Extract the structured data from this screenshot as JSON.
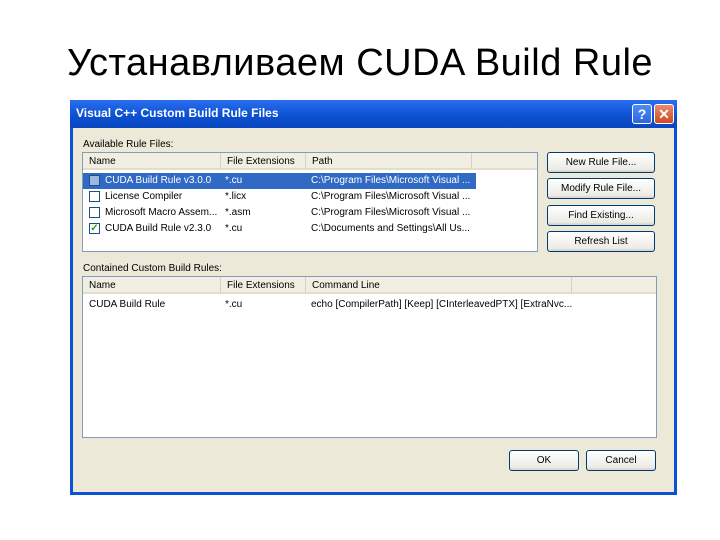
{
  "slide": {
    "title": "Устанавливаем CUDA Build Rule"
  },
  "dialog": {
    "title": "Visual C++ Custom Build Rule Files",
    "help_glyph": "?",
    "close_glyph": "✕",
    "available_label": "Available Rule Files:",
    "available_columns": [
      "Name",
      "File Extensions",
      "Path"
    ],
    "available_rows": [
      {
        "checked": false,
        "selected": true,
        "name": "CUDA Build Rule v3.0.0",
        "ext": "*.cu",
        "path": "C:\\Program Files\\Microsoft Visual ..."
      },
      {
        "checked": false,
        "selected": false,
        "name": "License Compiler",
        "ext": "*.licx",
        "path": "C:\\Program Files\\Microsoft Visual ..."
      },
      {
        "checked": false,
        "selected": false,
        "name": "Microsoft Macro Assem...",
        "ext": "*.asm",
        "path": "C:\\Program Files\\Microsoft Visual ..."
      },
      {
        "checked": true,
        "selected": false,
        "name": "CUDA Build Rule v2.3.0",
        "ext": "*.cu",
        "path": "C:\\Documents and Settings\\All Us..."
      }
    ],
    "buttons": {
      "new_rule": "New Rule File...",
      "modify_rule": "Modify Rule File...",
      "find_existing": "Find Existing...",
      "refresh": "Refresh List",
      "ok": "OK",
      "cancel": "Cancel"
    },
    "contained_label": "Contained Custom Build Rules:",
    "contained_columns": [
      "Name",
      "File Extensions",
      "Command Line"
    ],
    "contained_rows": [
      {
        "name": "CUDA Build Rule",
        "ext": "*.cu",
        "command": "echo [CompilerPath] [Keep] [CInterleavedPTX] [ExtraNvc..."
      }
    ],
    "check_glyph": "✓"
  },
  "colors": {
    "titlebar": "#0b4fd0",
    "dialog_bg": "#ece9d8",
    "selection": "#316ac5"
  }
}
